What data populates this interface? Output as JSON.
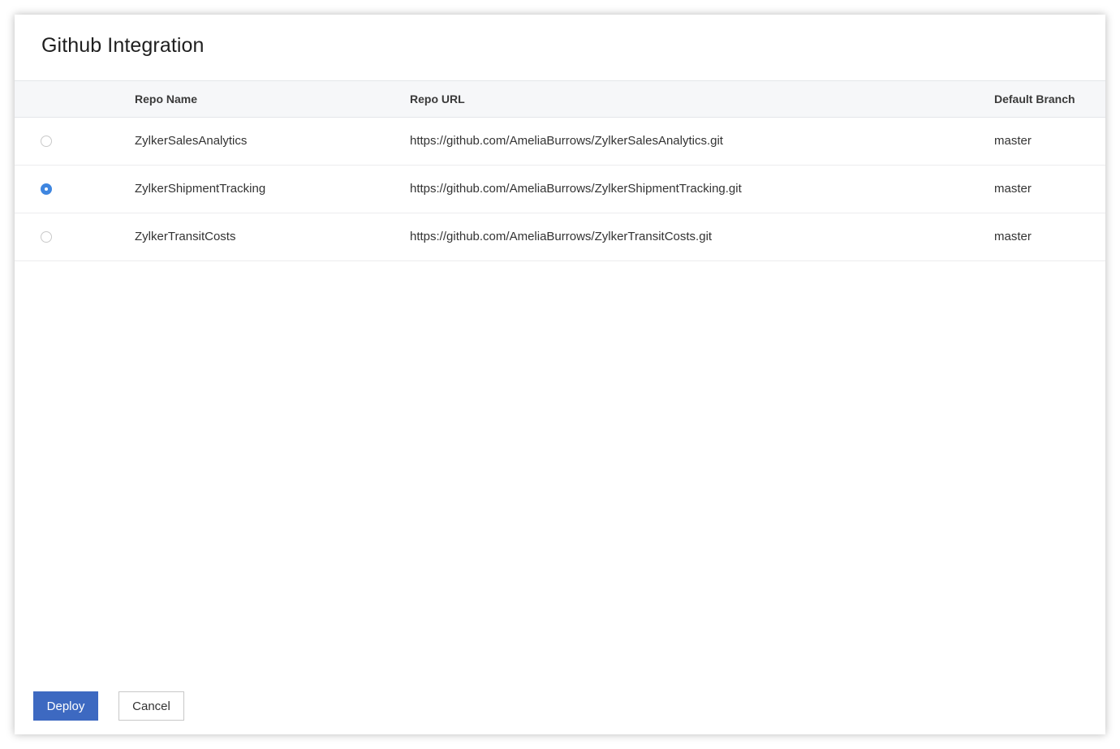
{
  "dialog": {
    "title": "Github Integration"
  },
  "table": {
    "headers": {
      "name": "Repo Name",
      "url": "Repo URL",
      "branch": "Default Branch"
    },
    "rows": [
      {
        "name": "ZylkerSalesAnalytics",
        "url": "https://github.com/AmeliaBurrows/ZylkerSalesAnalytics.git",
        "branch": "master",
        "selected": false
      },
      {
        "name": "ZylkerShipmentTracking",
        "url": "https://github.com/AmeliaBurrows/ZylkerShipmentTracking.git",
        "branch": "master",
        "selected": true
      },
      {
        "name": "ZylkerTransitCosts",
        "url": "https://github.com/AmeliaBurrows/ZylkerTransitCosts.git",
        "branch": "master",
        "selected": false
      }
    ]
  },
  "actions": {
    "deploy_label": "Deploy",
    "cancel_label": "Cancel"
  },
  "colors": {
    "primary": "#3d69c1",
    "radio_selected": "#3f86e0",
    "header_bg": "#f6f7f9"
  }
}
